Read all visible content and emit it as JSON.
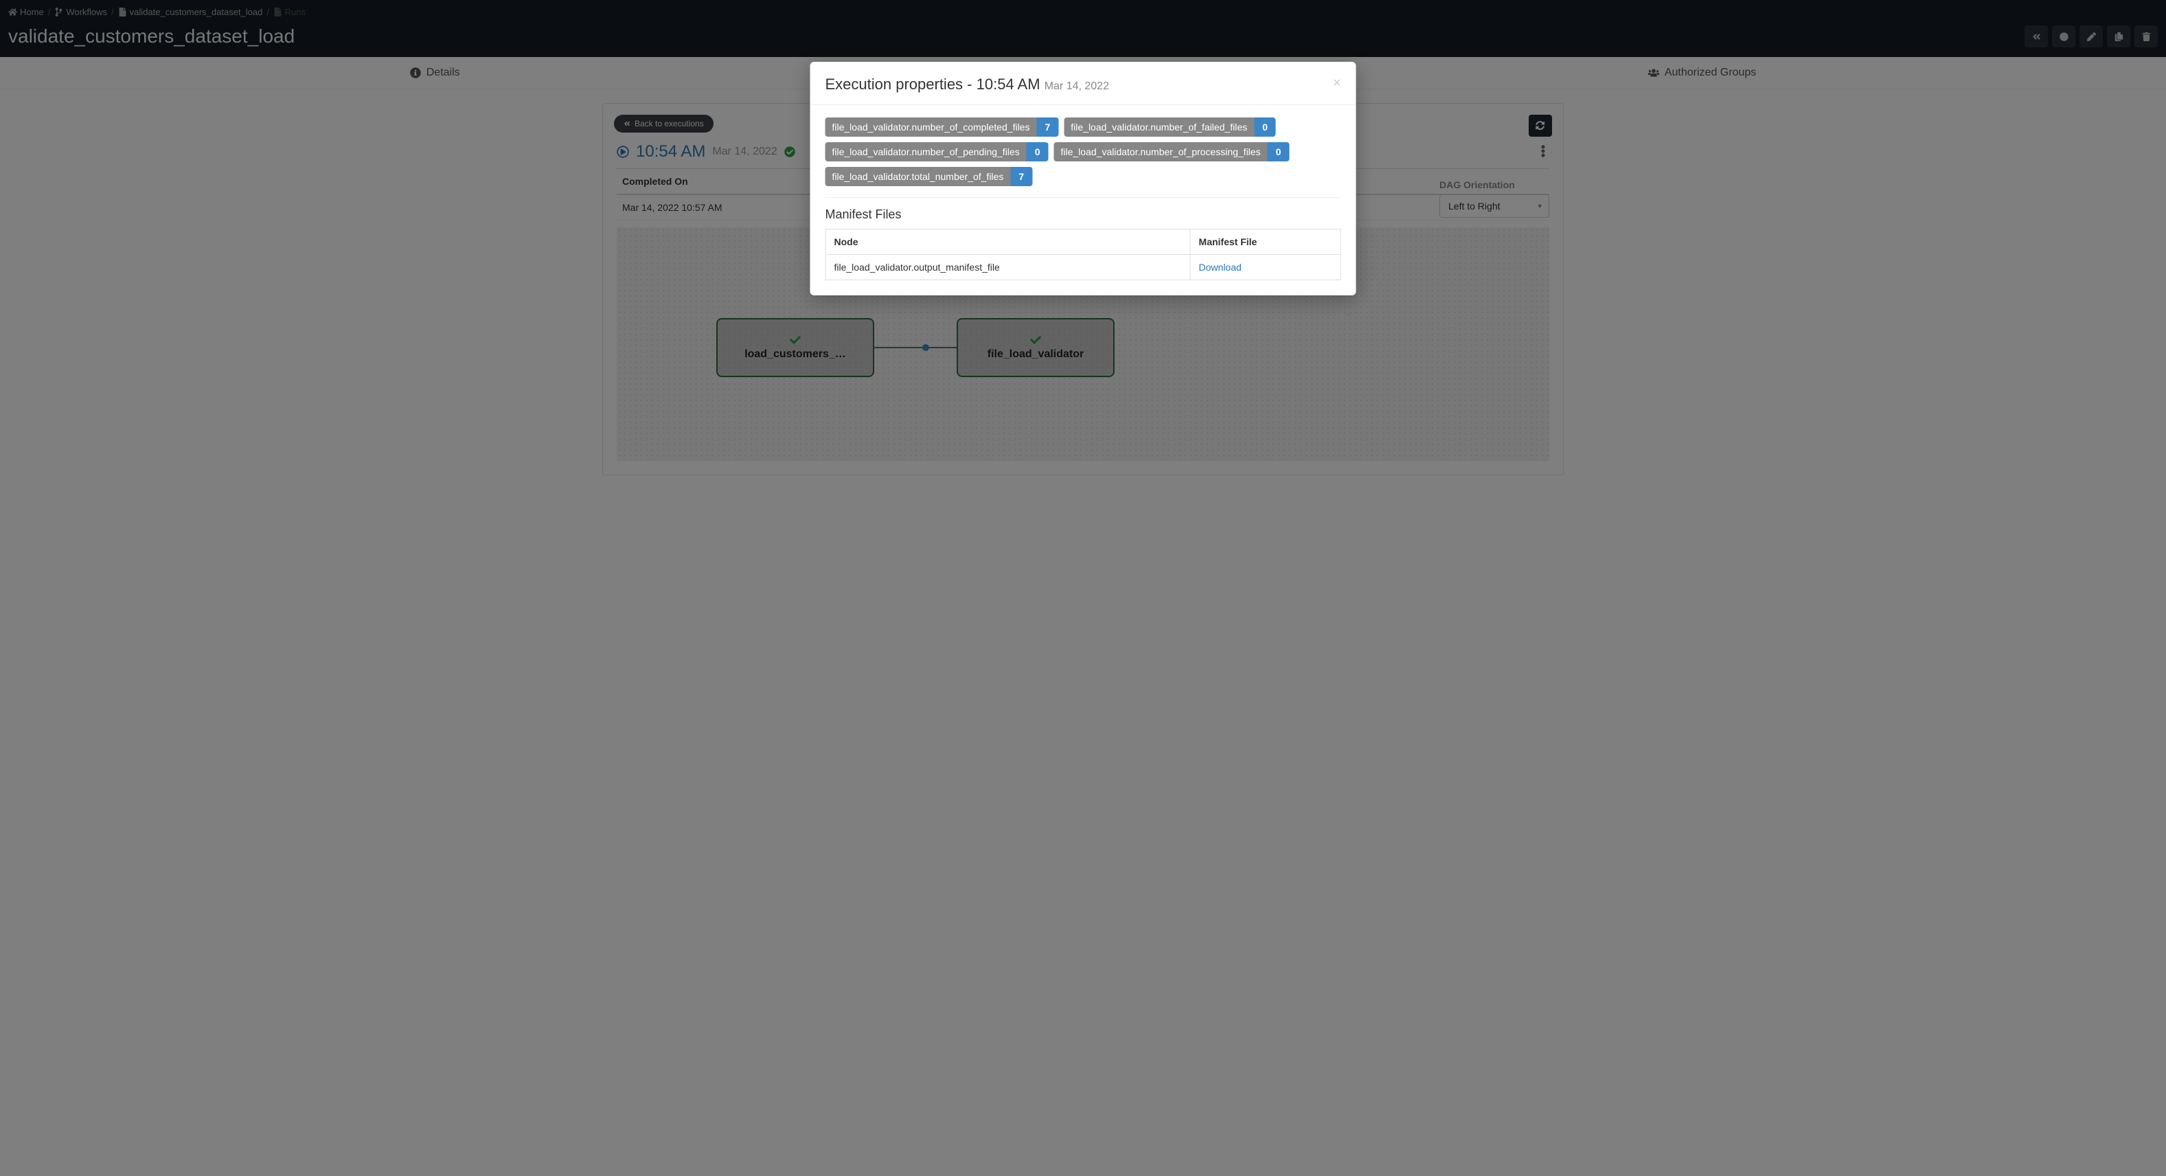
{
  "breadcrumbs": {
    "home": "Home",
    "workflows": "Workflows",
    "wf": "validate_customers_dataset_load",
    "runs": "Runs"
  },
  "page_title": "validate_customers_dataset_load",
  "tabs": {
    "details": "Details",
    "groups": "Authorized Groups"
  },
  "panel": {
    "back": "Back to executions",
    "run_time": "10:54 AM",
    "run_date": "Mar 14, 2022",
    "completed_on_label": "Completed On",
    "completed_on_value": "Mar 14, 2022 10:57 AM",
    "dag_orientation_label": "DAG Orientation",
    "dag_orientation_value": "Left to Right",
    "node1": "load_customers_…",
    "node2": "file_load_validator"
  },
  "modal": {
    "title_prefix": "Execution properties - ",
    "time": "10:54 AM",
    "date": "Mar 14, 2022",
    "close": "×",
    "badges": [
      {
        "label": "file_load_validator.number_of_completed_files",
        "value": "7"
      },
      {
        "label": "file_load_validator.number_of_failed_files",
        "value": "0"
      },
      {
        "label": "file_load_validator.number_of_pending_files",
        "value": "0"
      },
      {
        "label": "file_load_validator.number_of_processing_files",
        "value": "0"
      },
      {
        "label": "file_load_validator.total_number_of_files",
        "value": "7"
      }
    ],
    "manifest_title": "Manifest Files",
    "manifest_cols": {
      "node": "Node",
      "file": "Manifest File"
    },
    "manifest_rows": [
      {
        "node": "file_load_validator.output_manifest_file",
        "file": "Download"
      }
    ]
  }
}
